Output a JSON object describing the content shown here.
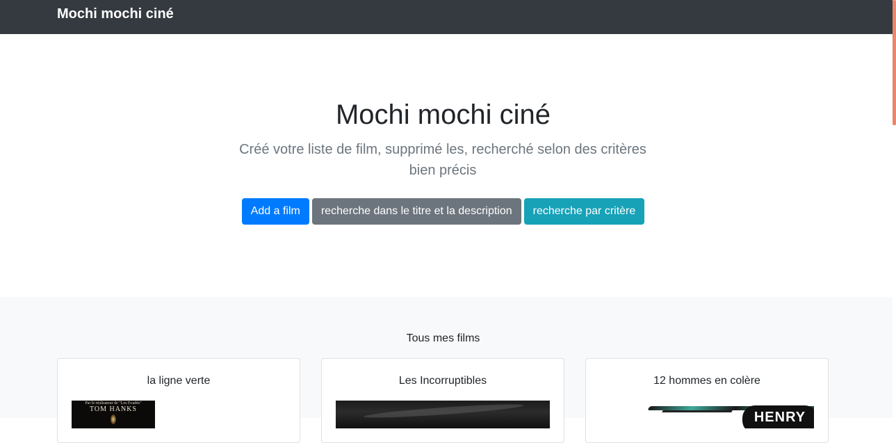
{
  "navbar": {
    "brand": "Mochi mochi ciné"
  },
  "jumbotron": {
    "title": "Mochi mochi ciné",
    "lead": "Créé votre liste de film, supprimé les, recherché selon des critères bien précis",
    "buttons": {
      "add": "Add a film",
      "search_text": "recherche dans le titre et la description",
      "search_criteria": "recherche par critère"
    }
  },
  "album": {
    "heading": "Tous mes films",
    "films": [
      {
        "title": "la ligne verte",
        "poster_text_small": "Par le réalisateur de \"Les Evadés\"",
        "poster_text_actor": "TOM HANKS"
      },
      {
        "title": "Les Incorruptibles"
      },
      {
        "title": "12 hommes en colère",
        "poster_text": "HENRY"
      }
    ]
  },
  "colors": {
    "navbar": "#343a40",
    "primary": "#007bff",
    "secondary": "#6c757d",
    "info": "#17a2b8",
    "album_bg": "#f8f9fa",
    "scrollbar": "#e9866c"
  }
}
